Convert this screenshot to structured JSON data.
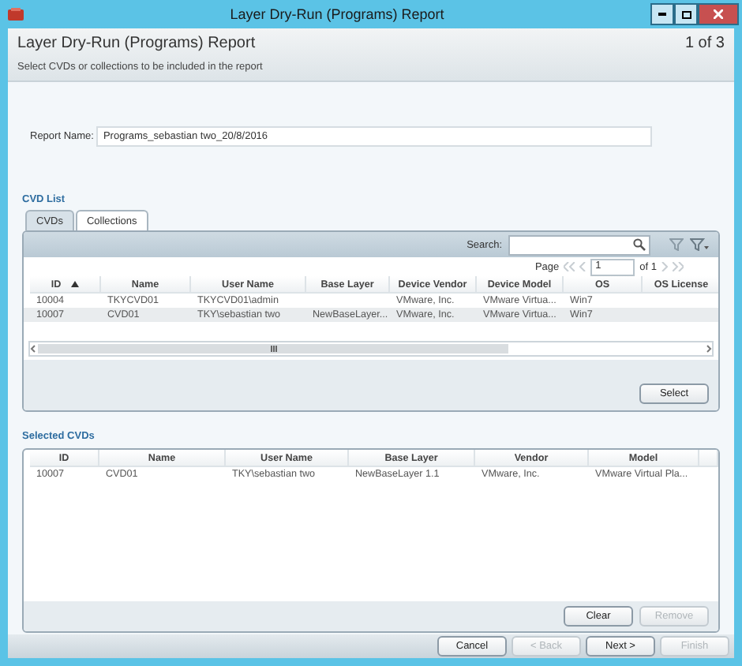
{
  "window": {
    "title": "Layer Dry-Run (Programs) Report"
  },
  "header": {
    "title": "Layer Dry-Run (Programs) Report",
    "step": "1 of 3",
    "subtitle": "Select CVDs or collections to be included in the report"
  },
  "report_name": {
    "label": "Report Name:",
    "value": "Programs_sebastian two_20/8/2016"
  },
  "cvd_list": {
    "label": "CVD List",
    "tabs": [
      {
        "label": "CVDs",
        "selected": true
      },
      {
        "label": "Collections",
        "selected": false
      }
    ],
    "search": {
      "label": "Search:"
    },
    "pager": {
      "label": "Page",
      "page": "1",
      "total": "of 1"
    },
    "columns": [
      {
        "label": "ID",
        "sorted": true
      },
      {
        "label": "Name",
        "sorted": false
      },
      {
        "label": "User Name",
        "sorted": false
      },
      {
        "label": "Base Layer",
        "sorted": false
      },
      {
        "label": "Device Vendor",
        "sorted": false
      },
      {
        "label": "Device Model",
        "sorted": false
      },
      {
        "label": "OS",
        "sorted": false
      },
      {
        "label": "OS License",
        "sorted": false
      }
    ],
    "rows": [
      {
        "selected": false,
        "cells": [
          "10004",
          "TKYCVD01",
          "TKYCVD01\\admin",
          "",
          "VMware, Inc.",
          "VMware Virtua...",
          "Win7",
          ""
        ]
      },
      {
        "selected": true,
        "cells": [
          "10007",
          "CVD01",
          "TKY\\sebastian two",
          "NewBaseLayer...",
          "VMware, Inc.",
          "VMware Virtua...",
          "Win7",
          ""
        ]
      }
    ],
    "button": {
      "label": "Select",
      "disabled": false
    }
  },
  "selected_cvds": {
    "label": "Selected CVDs",
    "columns": [
      "ID",
      "Name",
      "User Name",
      "Base Layer",
      "Vendor",
      "Model"
    ],
    "rows": [
      {
        "cells": [
          "10007",
          "CVD01",
          "TKY\\sebastian two",
          "NewBaseLayer 1.1",
          "VMware, Inc.",
          "VMware Virtual Pla..."
        ]
      }
    ],
    "buttons": [
      {
        "label": "Clear",
        "disabled": false
      },
      {
        "label": "Remove",
        "disabled": true
      }
    ]
  },
  "footer_buttons": [
    {
      "label": "Cancel",
      "disabled": false
    },
    {
      "label": "< Back",
      "disabled": true
    },
    {
      "label": "Next >",
      "disabled": false
    },
    {
      "label": "Finish",
      "disabled": true
    }
  ]
}
